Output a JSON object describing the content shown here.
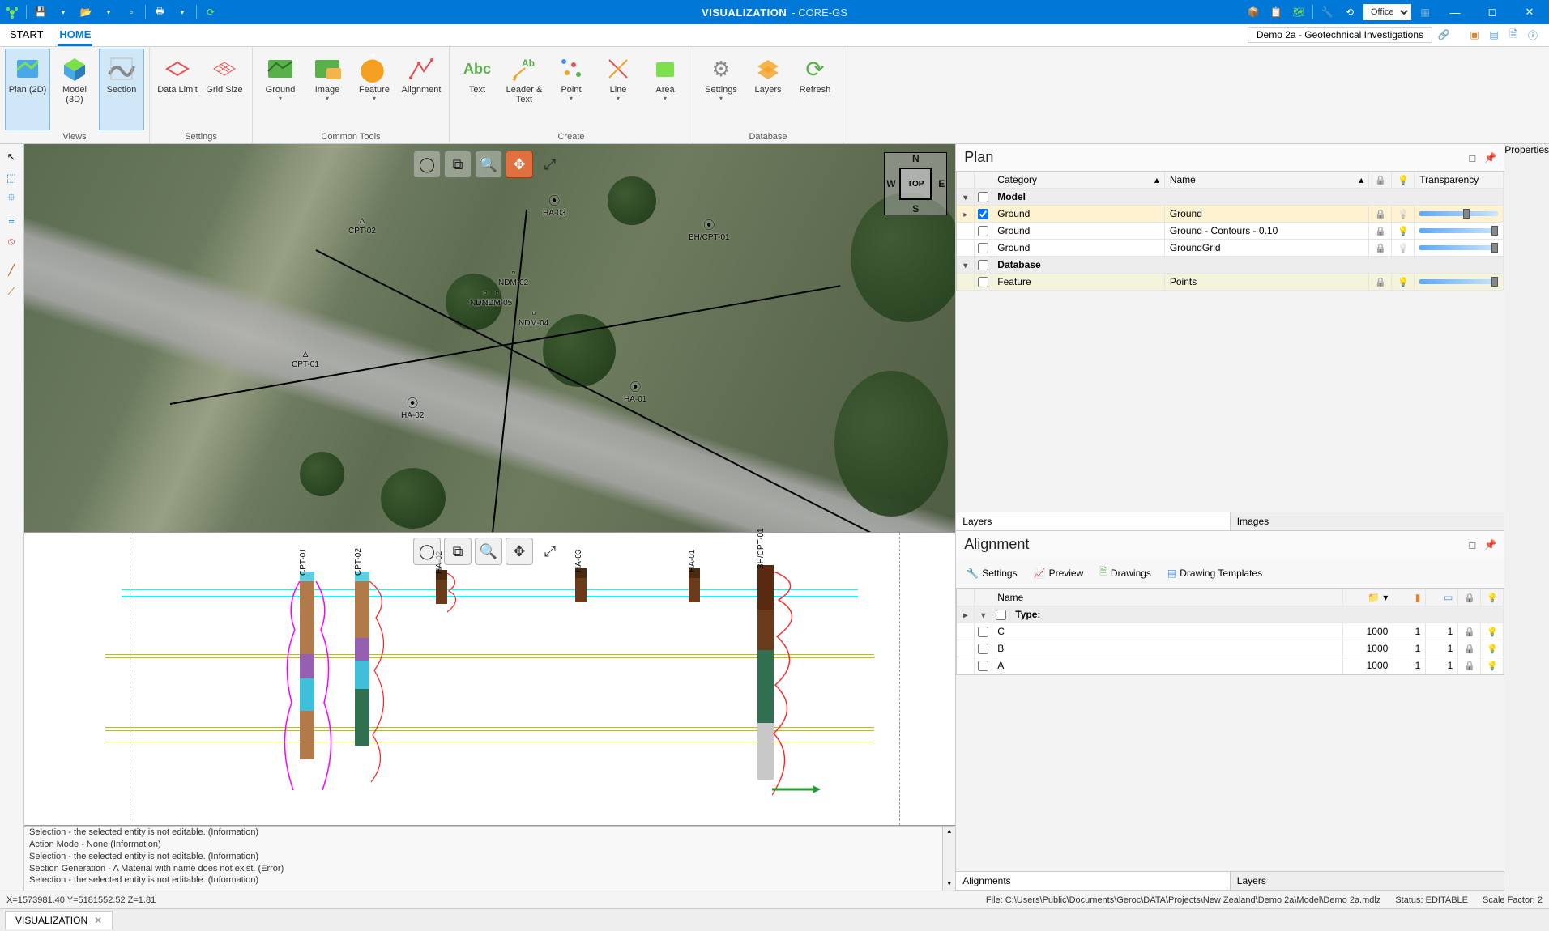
{
  "titlebar": {
    "title_main": "VISUALIZATION",
    "title_sub": " - CORE-GS",
    "theme_select": "Office"
  },
  "tabs": {
    "start": "START",
    "home": "HOME",
    "project_name": "Demo 2a - Geotechnical Investigations"
  },
  "ribbon": {
    "views": {
      "label": "Views",
      "plan2d": "Plan (2D)",
      "model3d": "Model (3D)",
      "section": "Section"
    },
    "settings": {
      "label": "Settings",
      "datalimit": "Data Limit",
      "gridsize": "Grid Size"
    },
    "commontools": {
      "label": "Common Tools",
      "ground": "Ground",
      "image": "Image",
      "feature": "Feature",
      "alignment": "Alignment"
    },
    "create": {
      "label": "Create",
      "text": "Text",
      "leader": "Leader & Text",
      "point": "Point",
      "line": "Line",
      "area": "Area"
    },
    "database": {
      "label": "Database",
      "settings": "Settings",
      "layers": "Layers",
      "refresh": "Refresh"
    }
  },
  "planview": {
    "compass_center": "TOP",
    "compass": {
      "n": "N",
      "s": "S",
      "e": "E",
      "w": "W"
    },
    "markers": {
      "cpt02": "CPT-02",
      "cpt01": "CPT-01",
      "ha02": "HA-02",
      "ha03": "HA-03",
      "ha01": "HA-01",
      "bhcpt01": "BH/CPT-01",
      "ndm02": "NDM-02",
      "ndm03": "NDM-03",
      "ndm04": "NDM-04",
      "ndm05": "NDM-05"
    }
  },
  "sectionview": {
    "boreholes": {
      "cpt01": "CPT-01",
      "cpt02": "CPT-02",
      "ha02": "HA-02",
      "ha03": "HA-03",
      "ha01": "HA-01",
      "bhcpt01": "BH/CPT-01"
    }
  },
  "log": {
    "l1": "Selection - the selected entity is not editable. (Information)",
    "l2": "Action Mode - None (Information)",
    "l3": "Selection - the selected entity is not editable. (Information)",
    "l4": "Section Generation - A Material with name  does not exist. (Error)",
    "l5": "Selection - the selected entity is not editable. (Information)"
  },
  "plan_panel": {
    "title": "Plan",
    "cols": {
      "category": "Category",
      "name": "Name",
      "transparency": "Transparency"
    },
    "group_model": "Model",
    "rows": [
      {
        "cat": "Ground",
        "name": "Ground",
        "checked": true,
        "thumb": 55
      },
      {
        "cat": "Ground",
        "name": "Ground - Contours - 0.10",
        "checked": false,
        "thumb": 100
      },
      {
        "cat": "Ground",
        "name": "GroundGrid",
        "checked": false,
        "thumb": 100
      }
    ],
    "group_database": "Database",
    "db_rows": [
      {
        "cat": "Feature",
        "name": "Points",
        "checked": false,
        "thumb": 100
      }
    ],
    "tabs": {
      "layers": "Layers",
      "images": "Images"
    }
  },
  "align_panel": {
    "title": "Alignment",
    "toolbar": {
      "settings": "Settings",
      "preview": "Preview",
      "drawings": "Drawings",
      "templates": "Drawing Templates"
    },
    "cols": {
      "name": "Name"
    },
    "group_type": "Type:",
    "rows": [
      {
        "name": "C",
        "a": "1000",
        "b": "1",
        "c": "1"
      },
      {
        "name": "B",
        "a": "1000",
        "b": "1",
        "c": "1"
      },
      {
        "name": "A",
        "a": "1000",
        "b": "1",
        "c": "1"
      }
    ],
    "tabs": {
      "alignments": "Alignments",
      "layers": "Layers"
    }
  },
  "properties_tab": "Properties",
  "status": {
    "coords": "X=1573981.40   Y=5181552.52   Z=1.81",
    "file": "File: C:\\Users\\Public\\Documents\\Geroc\\DATA\\Projects\\New Zealand\\Demo 2a\\Model\\Demo 2a.mdlz",
    "editable": "Status: EDITABLE",
    "scale": "Scale Factor: 2"
  },
  "bottom_tab": "VISUALIZATION"
}
